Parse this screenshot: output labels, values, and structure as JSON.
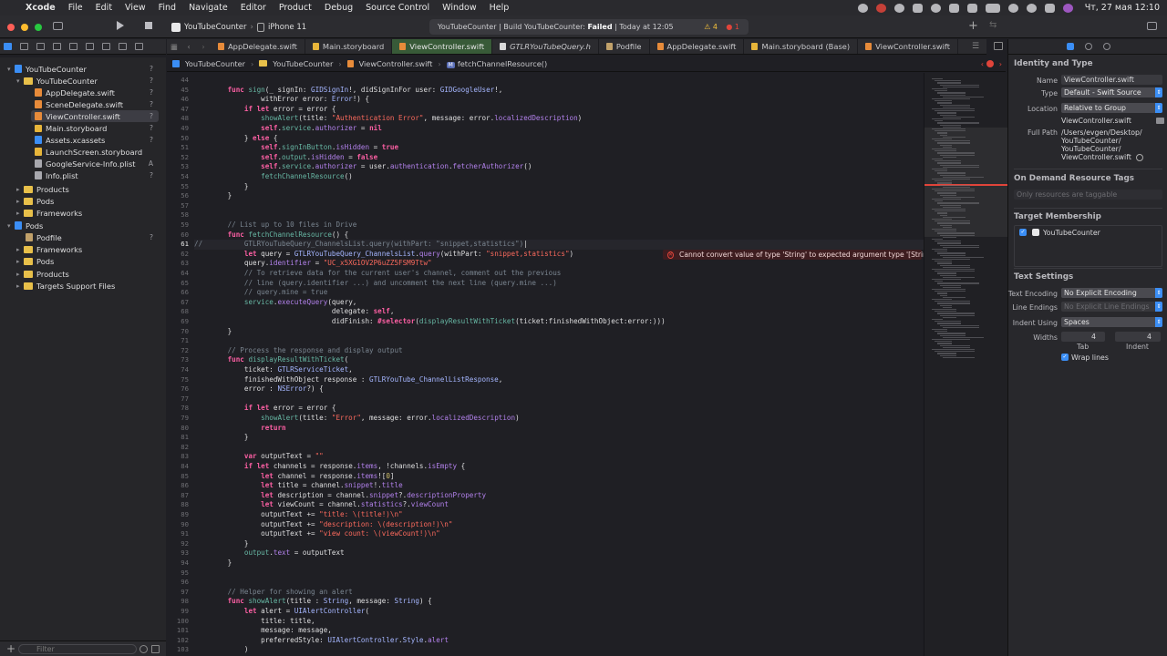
{
  "menubar": {
    "app": "Xcode",
    "items": [
      "File",
      "Edit",
      "View",
      "Find",
      "Navigate",
      "Editor",
      "Product",
      "Debug",
      "Source Control",
      "Window",
      "Help"
    ],
    "clock": "Чт, 27 мая  12:10"
  },
  "toolbar": {
    "scheme": "YouTubeCounter",
    "device": "iPhone 11",
    "activity_prefix": "YouTubeCounter | Build YouTubeCounter: ",
    "activity_status": "Failed",
    "activity_time": " | Today at 12:05",
    "warnings": "4",
    "errors": "1"
  },
  "tabs": [
    "AppDelegate.swift",
    "Main.storyboard",
    "ViewController.swift",
    "GTLRYouTubeQuery.h",
    "Podfile",
    "AppDelegate.swift",
    "Main.storyboard (Base)",
    "ViewController.swift"
  ],
  "navigator": {
    "items": [
      {
        "label": "YouTubeCounter",
        "status": "?"
      },
      {
        "label": "YouTubeCounter",
        "status": "?"
      },
      {
        "label": "AppDelegate.swift",
        "status": "?"
      },
      {
        "label": "SceneDelegate.swift",
        "status": "?"
      },
      {
        "label": "ViewController.swift",
        "status": "?"
      },
      {
        "label": "Main.storyboard",
        "status": "?"
      },
      {
        "label": "Assets.xcassets",
        "status": "?"
      },
      {
        "label": "LaunchScreen.storyboard",
        "status": ""
      },
      {
        "label": "GoogleService-Info.plist",
        "status": "A"
      },
      {
        "label": "Info.plist",
        "status": "?"
      },
      {
        "label": "Products",
        "status": ""
      },
      {
        "label": "Pods",
        "status": ""
      },
      {
        "label": "Frameworks",
        "status": ""
      },
      {
        "label": "Pods",
        "status": ""
      },
      {
        "label": "Podfile",
        "status": "?"
      },
      {
        "label": "Frameworks",
        "status": ""
      },
      {
        "label": "Pods",
        "status": ""
      },
      {
        "label": "Products",
        "status": ""
      },
      {
        "label": "Targets Support Files",
        "status": ""
      }
    ],
    "filter_placeholder": "Filter"
  },
  "breadcrumb": [
    "YouTubeCounter",
    "YouTubeCounter",
    "ViewController.swift",
    "fetchChannelResource()"
  ],
  "editor": {
    "line_numbers": [
      "44",
      "45",
      "46",
      "47",
      "48",
      "49",
      "50",
      "51",
      "52",
      "53",
      "54",
      "55",
      "56",
      "57",
      "58",
      "59",
      "60",
      "61",
      "62",
      "63",
      "64",
      "65",
      "66",
      "67",
      "68",
      "69",
      "70",
      "71",
      "72",
      "73",
      "74",
      "75",
      "76",
      "77",
      "78",
      "79",
      "80",
      "81",
      "82",
      "83",
      "84",
      "85",
      "86",
      "87",
      "88",
      "89",
      "90",
      "91",
      "92",
      "93",
      "94",
      "95",
      "96",
      "97",
      "98",
      "99",
      "100",
      "101",
      "102",
      "103"
    ],
    "error_message": "Cannot convert value of type 'String' to expected argument type '[String]'"
  },
  "inspector": {
    "identity_title": "Identity and Type",
    "name_label": "Name",
    "name_value": "ViewController.swift",
    "type_label": "Type",
    "type_value": "Default - Swift Source",
    "location_label": "Location",
    "location_value": "Relative to Group",
    "location_file": "ViewController.swift",
    "fullpath_label": "Full Path",
    "fullpath_lines": [
      "/Users/evgen/Desktop/",
      "YouTubeCounter/",
      "YouTubeCounter/",
      "ViewController.swift"
    ],
    "odr_title": "On Demand Resource Tags",
    "odr_placeholder": "Only resources are taggable",
    "target_title": "Target Membership",
    "target_item": "YouTubeCounter",
    "text_title": "Text Settings",
    "encoding_label": "Text Encoding",
    "encoding_value": "No Explicit Encoding",
    "lineendings_label": "Line Endings",
    "lineendings_value": "No Explicit Line Endings",
    "indent_label": "Indent Using",
    "indent_value": "Spaces",
    "widths_label": "Widths",
    "tab_value": "4",
    "indent_width_value": "4",
    "tab_caption": "Tab",
    "indent_caption": "Indent",
    "wrap_label": "Wrap lines"
  }
}
